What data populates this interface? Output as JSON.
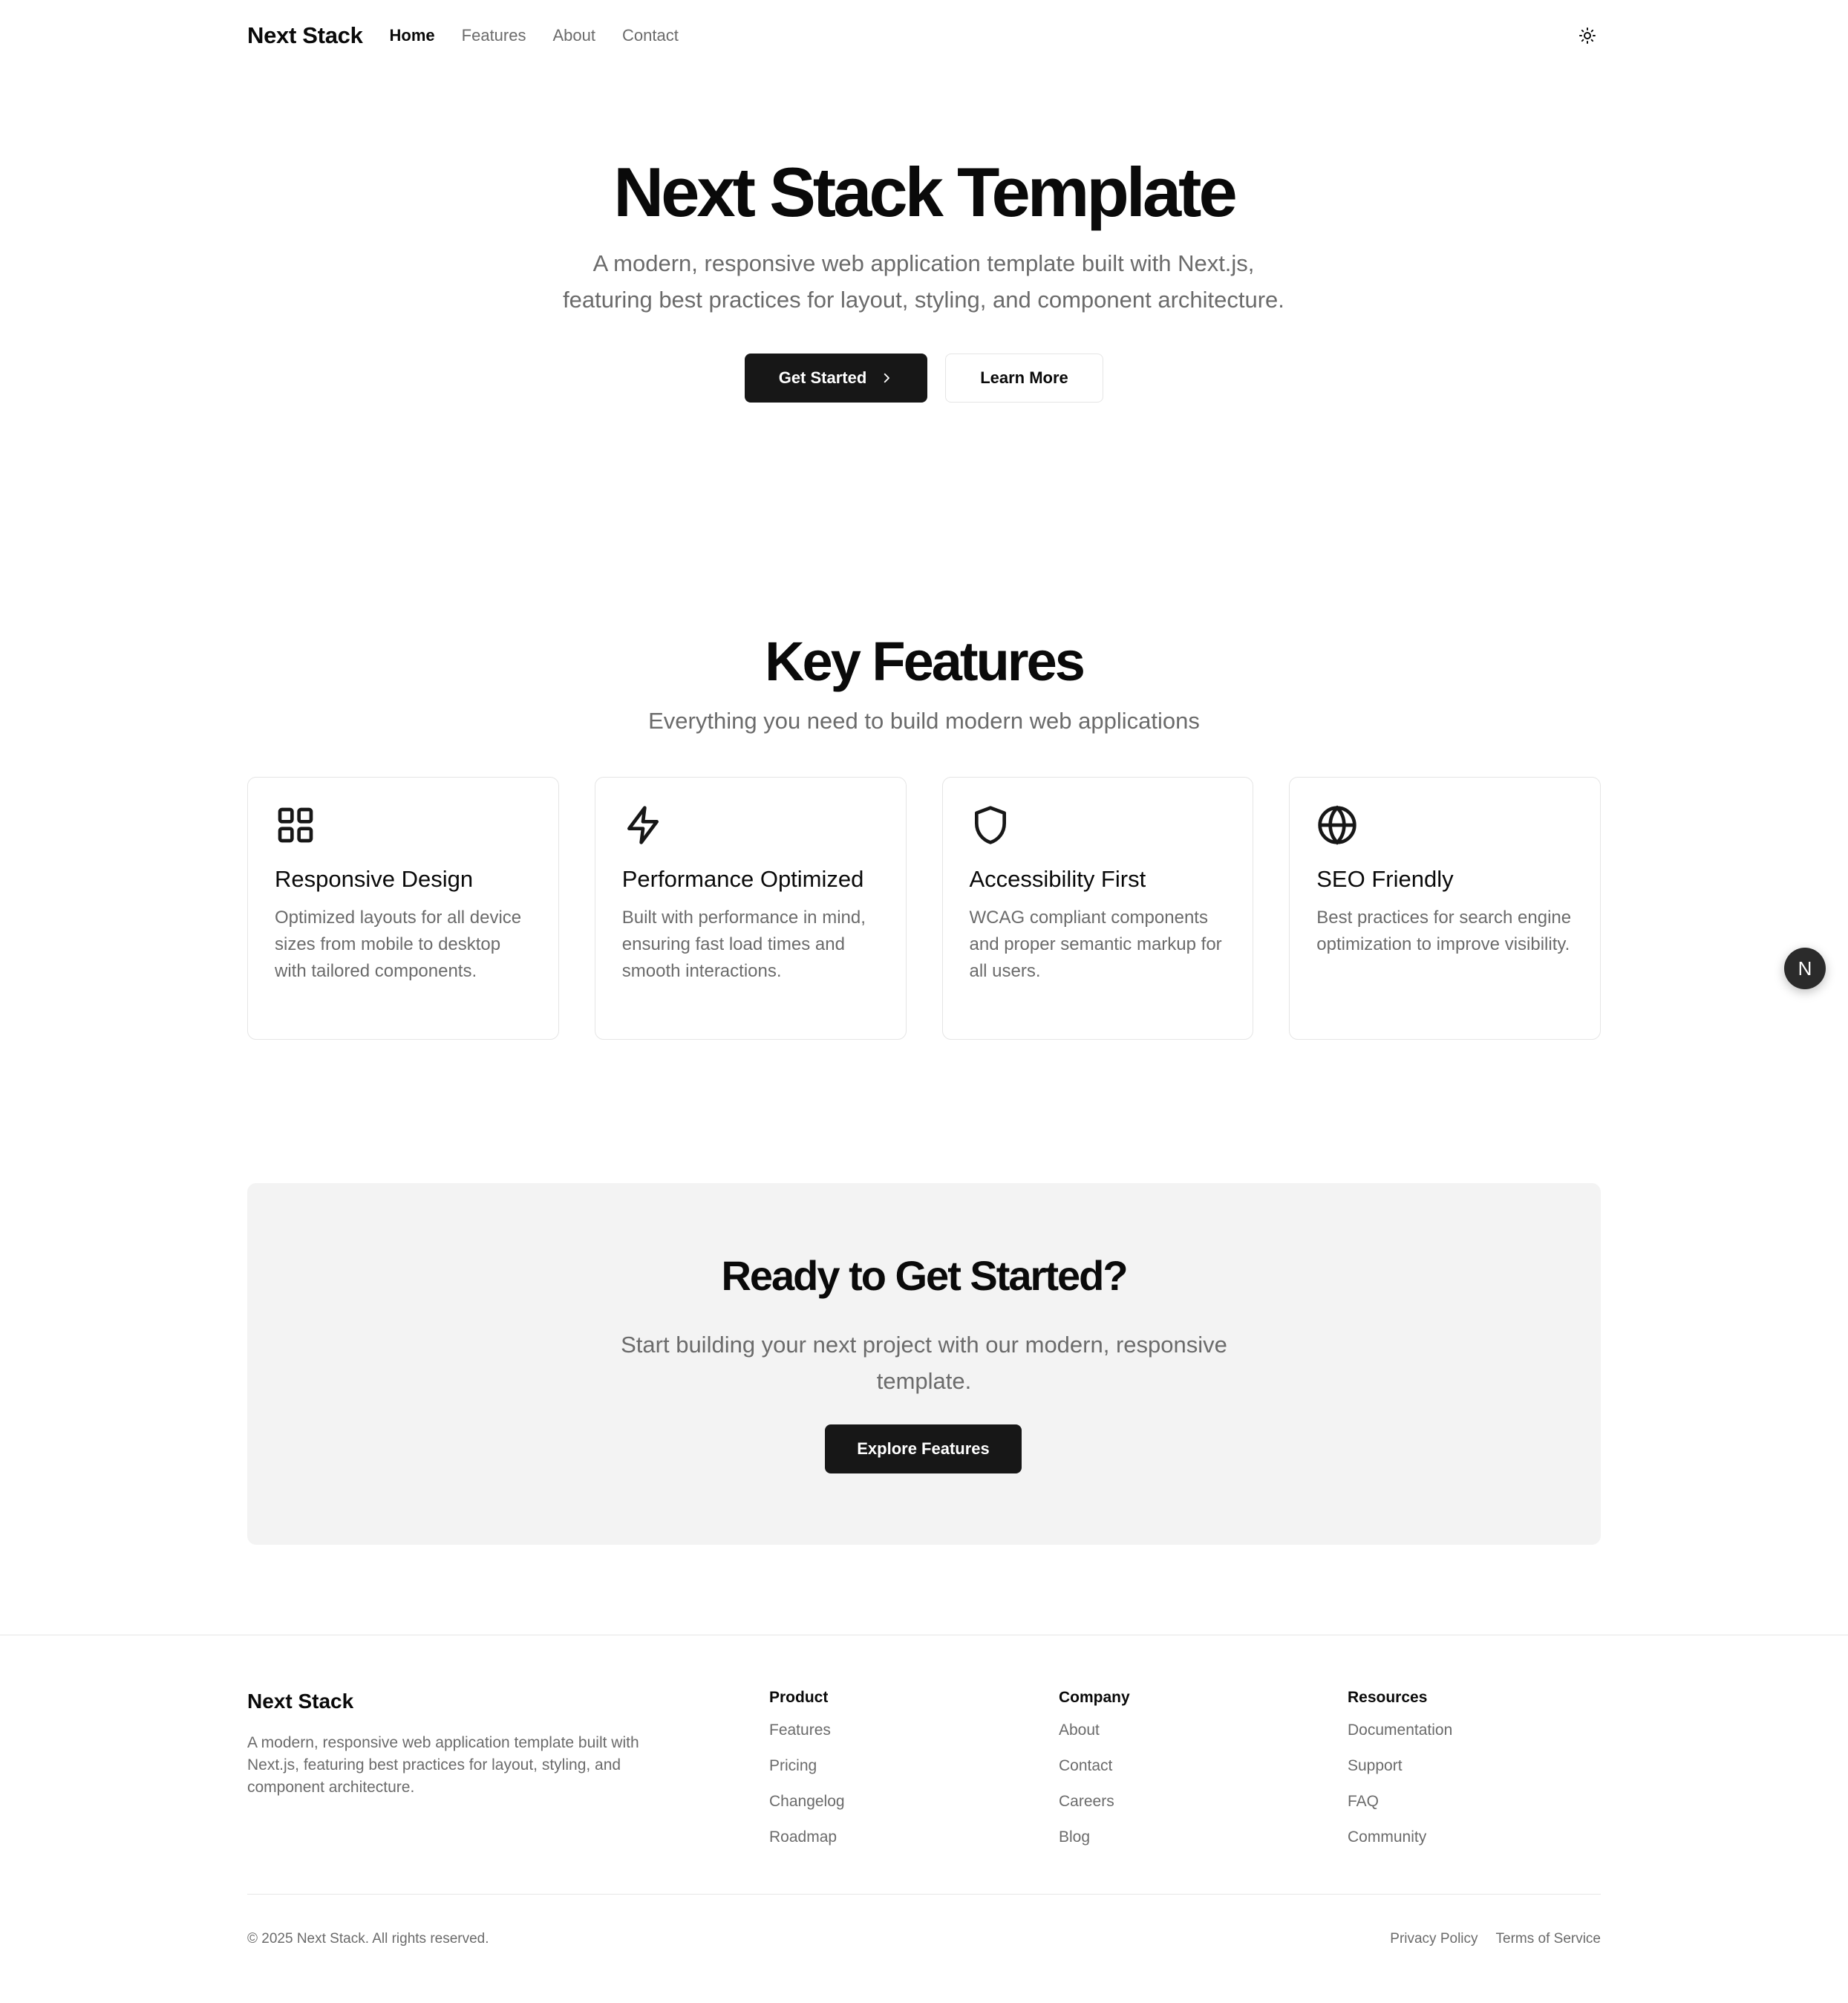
{
  "nav": {
    "brand": "Next Stack",
    "links": [
      "Home",
      "Features",
      "About",
      "Contact"
    ],
    "active": "Home",
    "theme_toggle_icon": "sun-icon"
  },
  "hero": {
    "title": "Next Stack Template",
    "subtitle_line1": "A modern, responsive web application template built with Next.js,",
    "subtitle_line2": "featuring best practices for layout, styling, and component architecture.",
    "primary_button": "Get Started",
    "secondary_button": "Learn More"
  },
  "features": {
    "title": "Key Features",
    "subtitle": "Everything you need to build modern web applications",
    "cards": [
      {
        "icon": "grid-icon",
        "title": "Responsive Design",
        "desc": "Optimized layouts for all device sizes from mobile to desktop with tailored components."
      },
      {
        "icon": "lightning-icon",
        "title": "Performance Optimized",
        "desc": "Built with performance in mind, ensuring fast load times and smooth interactions."
      },
      {
        "icon": "shield-icon",
        "title": "Accessibility First",
        "desc": "WCAG compliant components and proper semantic markup for all users."
      },
      {
        "icon": "globe-icon",
        "title": "SEO Friendly",
        "desc": "Best practices for search engine optimization to improve visibility."
      }
    ]
  },
  "cta": {
    "title": "Ready to Get Started?",
    "subtitle_line1": "Start building your next project with our modern, responsive",
    "subtitle_line2": "template.",
    "button": "Explore Features"
  },
  "footer": {
    "brand": "Next Stack",
    "description": "A modern, responsive web application template built with Next.js, featuring best practices for layout, styling, and component architecture.",
    "columns": [
      {
        "title": "Product",
        "links": [
          "Features",
          "Pricing",
          "Changelog",
          "Roadmap"
        ]
      },
      {
        "title": "Company",
        "links": [
          "About",
          "Contact",
          "Careers",
          "Blog"
        ]
      },
      {
        "title": "Resources",
        "links": [
          "Documentation",
          "Support",
          "FAQ",
          "Community"
        ]
      }
    ],
    "copyright": "© 2025 Next Stack. All rights reserved.",
    "legal": [
      "Privacy Policy",
      "Terms of Service"
    ]
  },
  "fab_label": "N",
  "colors": {
    "primary": "#171717",
    "muted": "#6b6b6b",
    "border": "#e5e5e5",
    "cta_bg": "#f3f3f3"
  }
}
